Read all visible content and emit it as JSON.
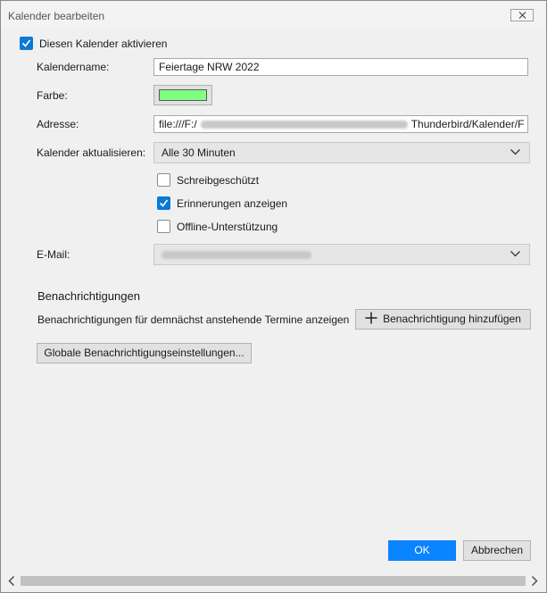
{
  "window": {
    "title": "Kalender bearbeiten"
  },
  "enable": {
    "label": "Diesen Kalender aktivieren",
    "checked": true
  },
  "form": {
    "name_label": "Kalendername:",
    "name_value": "Feiertage NRW 2022",
    "color_label": "Farbe:",
    "color_value": "#80ff80",
    "address_label": "Adresse:",
    "address_prefix": "file:///F:/",
    "address_suffix": "Thunderbird/Kalender/F",
    "refresh_label": "Kalender aktualisieren:",
    "refresh_value": "Alle 30 Minuten",
    "readonly_label": "Schreibgeschützt",
    "readonly_checked": false,
    "reminders_label": "Erinnerungen anzeigen",
    "reminders_checked": true,
    "offline_label": "Offline-Unterstützung",
    "offline_checked": false,
    "email_label": "E-Mail:"
  },
  "notifications": {
    "heading": "Benachrichtigungen",
    "description": "Benachrichtigungen für demnächst anstehende Termine anzeigen",
    "add_button": "Benachrichtigung hinzufügen",
    "global_button": "Globale Benachrichtigungseinstellungen..."
  },
  "footer": {
    "ok": "OK",
    "cancel": "Abbrechen"
  },
  "colors": {
    "accent": "#0a84ff",
    "checkbox": "#0a7ad4"
  }
}
